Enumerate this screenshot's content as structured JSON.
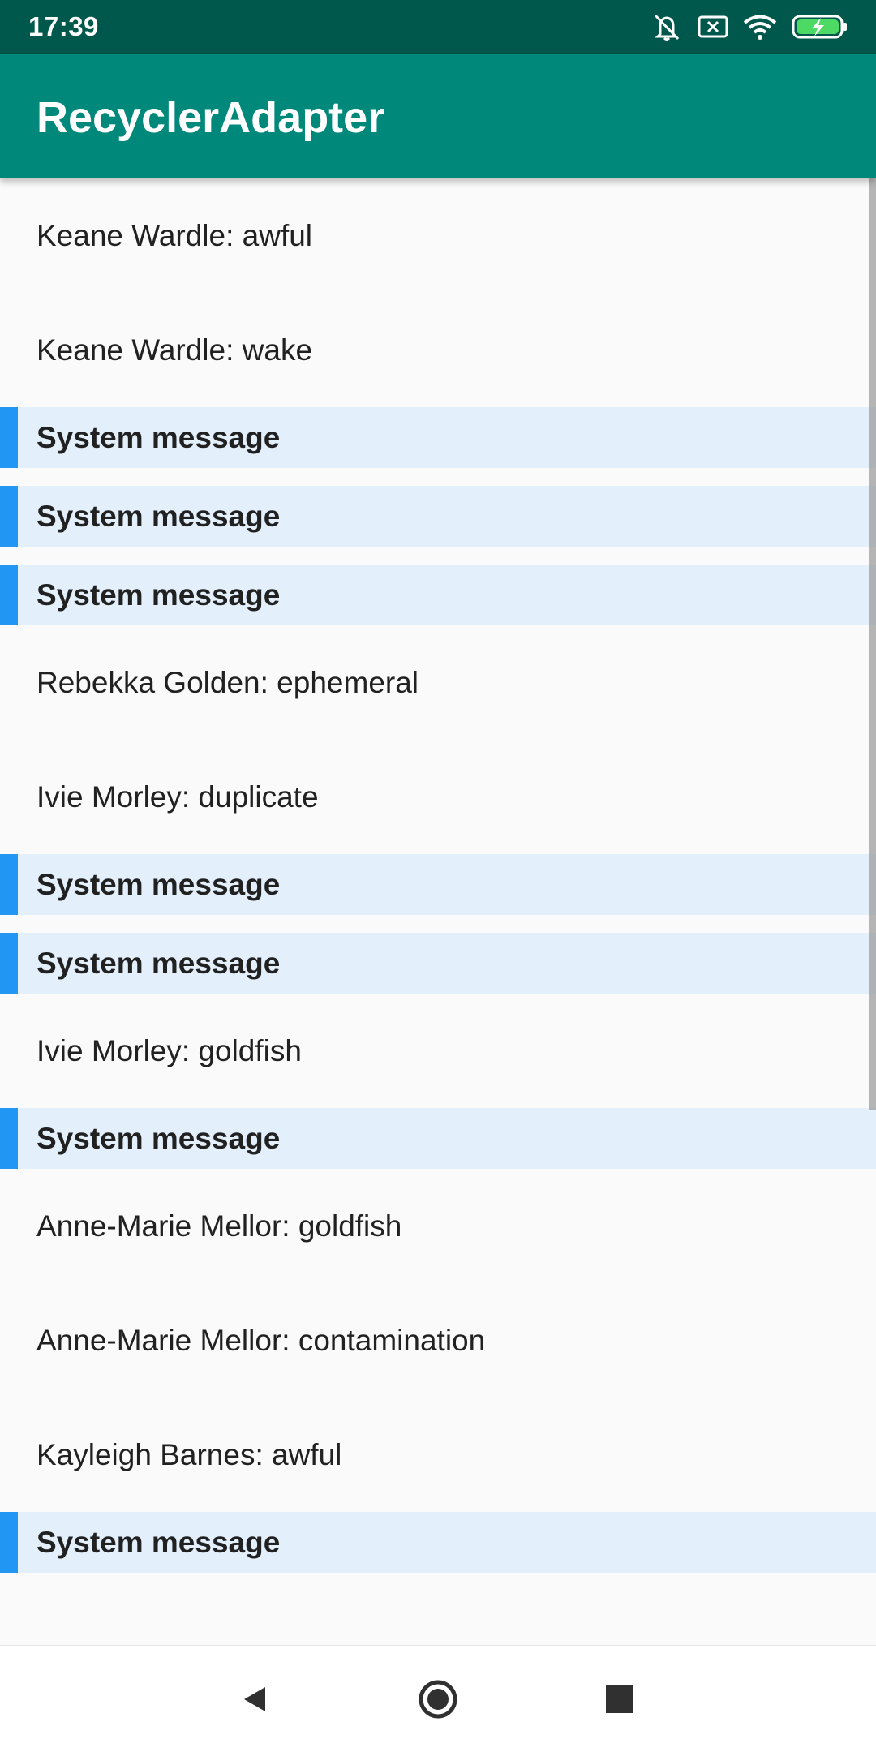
{
  "status_bar": {
    "time": "17:39",
    "icons": [
      "silent-mode-icon",
      "sim-error-icon",
      "wifi-icon",
      "battery-charging-icon"
    ]
  },
  "app_bar": {
    "title": "RecyclerAdapter",
    "background": "#00897b",
    "status_background": "#00574b"
  },
  "list": {
    "system_accent": "#2196f3",
    "system_background": "#e3f0fc",
    "items": [
      {
        "type": "user",
        "text": "Keane Wardle: awful"
      },
      {
        "type": "user",
        "text": "Keane Wardle: wake"
      },
      {
        "type": "system",
        "text": "System message"
      },
      {
        "type": "system",
        "text": "System message"
      },
      {
        "type": "system",
        "text": "System message"
      },
      {
        "type": "user",
        "text": "Rebekka Golden: ephemeral"
      },
      {
        "type": "user",
        "text": "Ivie Morley: duplicate"
      },
      {
        "type": "system",
        "text": "System message"
      },
      {
        "type": "system",
        "text": "System message"
      },
      {
        "type": "user",
        "text": "Ivie Morley: goldfish"
      },
      {
        "type": "system",
        "text": "System message"
      },
      {
        "type": "user",
        "text": "Anne-Marie Mellor: goldfish"
      },
      {
        "type": "user",
        "text": "Anne-Marie Mellor: contamination"
      },
      {
        "type": "user",
        "text": "Kayleigh Barnes: awful"
      },
      {
        "type": "system",
        "text": "System message"
      }
    ]
  },
  "nav_bar": {
    "buttons": [
      "back-icon",
      "home-icon",
      "recents-icon"
    ]
  }
}
